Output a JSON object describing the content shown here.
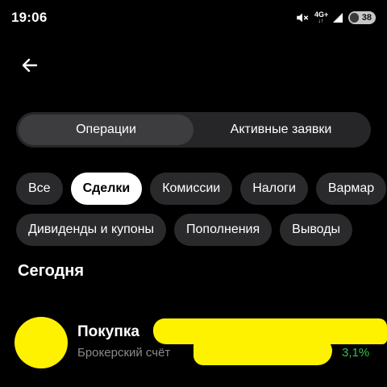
{
  "status_bar": {
    "time": "19:06",
    "network": "4G+",
    "network_arrows": "↓↑",
    "battery": "38",
    "icons": [
      "mute-icon",
      "signal-icon",
      "battery-icon"
    ]
  },
  "header": {
    "back_icon": "arrow-left-icon"
  },
  "segments": {
    "items": [
      {
        "label": "Операции",
        "active": true
      },
      {
        "label": "Активные заявки",
        "active": false
      }
    ]
  },
  "filters": {
    "row1": [
      {
        "label": "Все",
        "selected": false
      },
      {
        "label": "Сделки",
        "selected": true
      },
      {
        "label": "Комиссии",
        "selected": false
      },
      {
        "label": "Налоги",
        "selected": false
      },
      {
        "label": "Вармар",
        "selected": false
      }
    ],
    "row2": [
      {
        "label": "Дивиденды и купоны",
        "selected": false
      },
      {
        "label": "Пополнения",
        "selected": false
      },
      {
        "label": "Выводы",
        "selected": false
      }
    ]
  },
  "section": {
    "title": "Сегодня"
  },
  "operation": {
    "title": "Покупка",
    "subtitle": "Брокерский счёт",
    "change": "3,1%"
  },
  "colors": {
    "background": "#000000",
    "chip": "#2a2a2c",
    "chip_selected": "#ffffff",
    "positive": "#2fc24f",
    "redaction": "#fff200"
  }
}
